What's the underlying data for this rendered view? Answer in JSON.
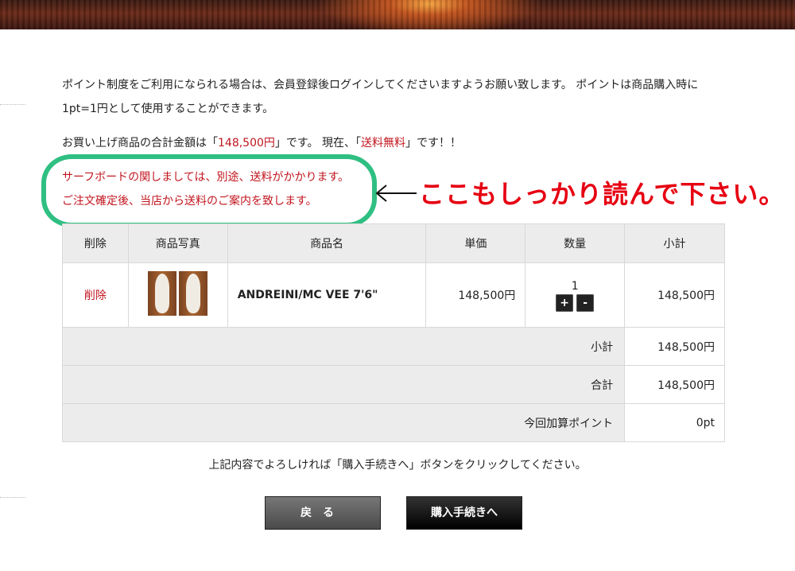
{
  "info": {
    "points_line": "ポイント制度をご利用になられる場合は、会員登録後ログインしてくださいますようお願い致します。 ポイントは商品購入時に1pt=1円として使用することができます。",
    "total_pre": "お買い上げ商品の合計金額は「",
    "total_amount": "148,500円",
    "total_mid": "」です。 現在、「",
    "shipping_status": "送料無料",
    "total_post": "」です！！"
  },
  "notice": {
    "line1": "サーフボードの関しましては、別途、送料がかかります。",
    "line2": "ご注文確定後、当店から送料のご案内を致します。"
  },
  "annotation": {
    "text": "ここもしっかり読んで下さい。",
    "ring_color": "#2fbf82",
    "text_color": "#e60012"
  },
  "cart": {
    "headers": [
      "削除",
      "商品写真",
      "商品名",
      "単価",
      "数量",
      "小計"
    ],
    "item": {
      "delete_label": "削除",
      "name": "ANDREINI/MC VEE 7'6\"",
      "price": "148,500円",
      "quantity": "1",
      "plus_label": "+",
      "minus_label": "-",
      "subtotal": "148,500円"
    },
    "summary": [
      {
        "label": "小計",
        "value": "148,500円"
      },
      {
        "label": "合計",
        "value": "148,500円"
      },
      {
        "label": "今回加算ポイント",
        "value": "0pt"
      }
    ]
  },
  "confirm_text": "上記内容でよろしければ「購入手続きへ」ボタンをクリックしてください。",
  "buttons": {
    "back": "戻る",
    "checkout": "購入手続きへ"
  },
  "colors": {
    "accent_red": "#c1161f",
    "header_bg": "#ececec"
  }
}
